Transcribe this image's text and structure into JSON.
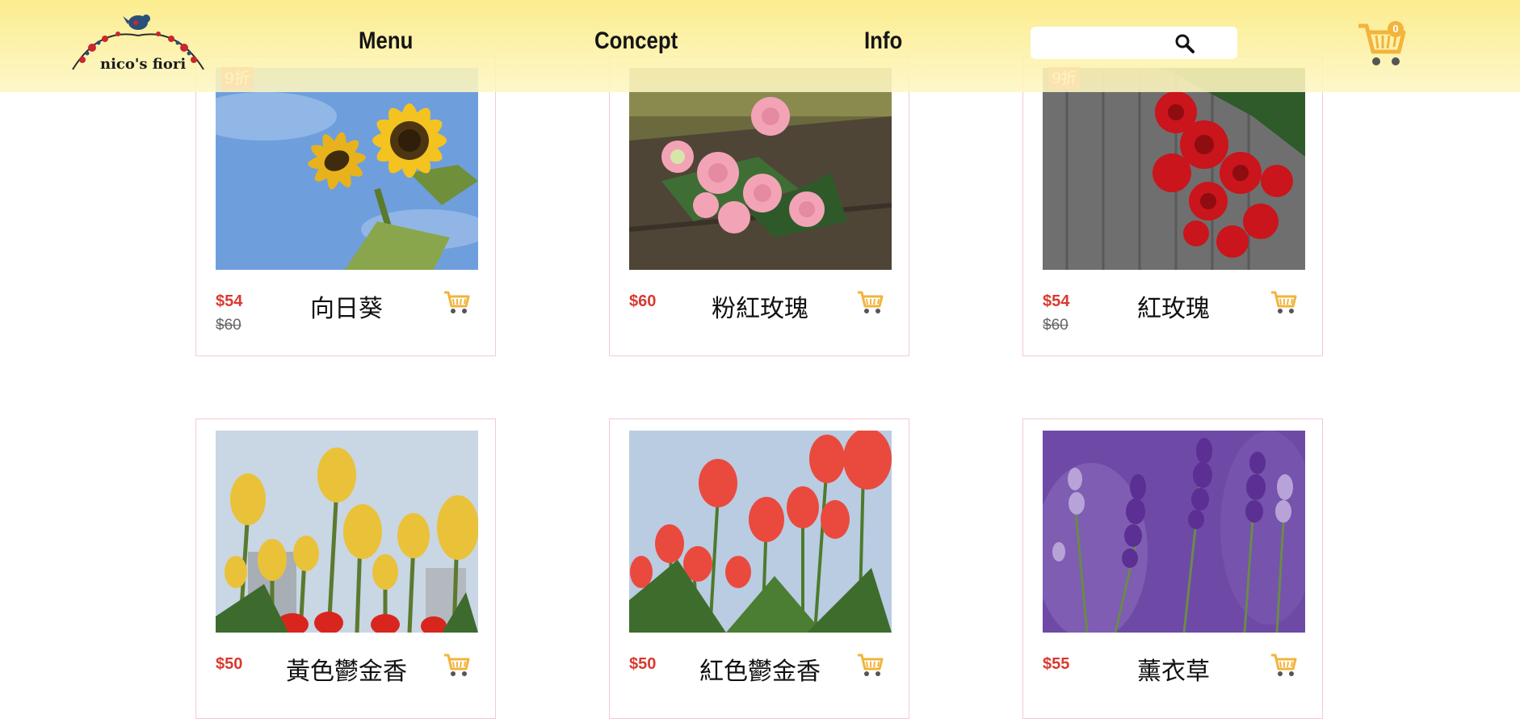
{
  "header": {
    "logo_text": "nico's fiori",
    "nav": [
      "Menu",
      "Concept",
      "Info"
    ],
    "search": {
      "value": "",
      "placeholder": ""
    },
    "cart_count": "0",
    "icons": {
      "search": "magnifier-icon",
      "cart": "shopping-cart-icon"
    }
  },
  "colors": {
    "header_bg": "#fcec8a",
    "price": "#d93a30",
    "badge": "#e9574f",
    "card_border": "#f7c9d1",
    "cart_icon": "#f2b43c"
  },
  "products": [
    {
      "name": "向日葵",
      "price": "$54",
      "original_price": "$60",
      "badge": "9折",
      "image": "sunflower"
    },
    {
      "name": "粉紅玫瑰",
      "price": "$60",
      "original_price": "",
      "badge": "",
      "image": "pink-roses"
    },
    {
      "name": "紅玫瑰",
      "price": "$54",
      "original_price": "$60",
      "badge": "9折",
      "image": "red-roses"
    },
    {
      "name": "黃色鬱金香",
      "price": "$50",
      "original_price": "",
      "badge": "",
      "image": "yellow-tulips"
    },
    {
      "name": "紅色鬱金香",
      "price": "$50",
      "original_price": "",
      "badge": "",
      "image": "red-tulips"
    },
    {
      "name": "薰衣草",
      "price": "$55",
      "original_price": "",
      "badge": "",
      "image": "lavender"
    }
  ]
}
